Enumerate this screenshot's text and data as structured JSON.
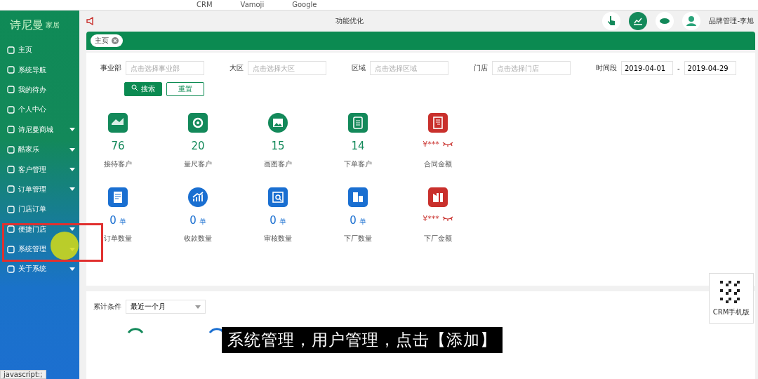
{
  "bookmarks": [
    "CRM",
    "Vamoji",
    "Google"
  ],
  "sidebar": {
    "logo": "诗尼曼",
    "logo_sub": "家居",
    "items": [
      {
        "label": "主页",
        "expandable": false
      },
      {
        "label": "系统导航",
        "expandable": false
      },
      {
        "label": "我的待办",
        "expandable": false
      },
      {
        "label": "个人中心",
        "expandable": false
      },
      {
        "label": "诗尼曼商城",
        "expandable": true
      },
      {
        "label": "酷家乐",
        "expandable": true
      },
      {
        "label": "客户管理",
        "expandable": true
      },
      {
        "label": "订单管理",
        "expandable": true
      },
      {
        "label": "门店订单",
        "expandable": false
      },
      {
        "label": "便捷门店",
        "expandable": true
      },
      {
        "label": "系统管理",
        "expandable": true
      },
      {
        "label": "关于系统",
        "expandable": true
      }
    ]
  },
  "topbar": {
    "notice": "功能优化",
    "user": "品牌管理-李旭"
  },
  "tabs": [
    {
      "label": "主页",
      "selected": true
    }
  ],
  "filters": [
    {
      "label": "事业部",
      "placeholder": "点击选择事业部"
    },
    {
      "label": "大区",
      "placeholder": "点击选择大区"
    },
    {
      "label": "区域",
      "placeholder": "点击选择区域"
    },
    {
      "label": "门店",
      "placeholder": "点击选择门店"
    }
  ],
  "period": {
    "label": "时间段",
    "start": "2019-04-01",
    "separator": "-",
    "end": "2019-04-29"
  },
  "buttons": {
    "search": "搜索",
    "reset": "重置"
  },
  "stats": [
    {
      "kind": "count",
      "value": "76",
      "label": "接待客户",
      "color": "#13895a"
    },
    {
      "kind": "count",
      "value": "20",
      "label": "量尺客户",
      "color": "#13895a"
    },
    {
      "kind": "count",
      "value": "15",
      "label": "画图客户",
      "color": "#13895a"
    },
    {
      "kind": "count",
      "value": "14",
      "label": "下单客户",
      "color": "#13895a"
    },
    {
      "kind": "amount",
      "value": "¥***",
      "label": "合同金额",
      "color": "#c9302c"
    },
    {
      "kind": "count",
      "value": "0",
      "unit": "单",
      "label": "订单数量",
      "color": "#1a6fd1"
    },
    {
      "kind": "count",
      "value": "0",
      "unit": "单",
      "label": "收款数量",
      "color": "#1a6fd1"
    },
    {
      "kind": "count",
      "value": "0",
      "unit": "单",
      "label": "审核数量",
      "color": "#1a6fd1"
    },
    {
      "kind": "count",
      "value": "0",
      "unit": "单",
      "label": "下厂数量",
      "color": "#1a6fd1"
    },
    {
      "kind": "amount",
      "value": "¥***",
      "label": "下厂金额",
      "color": "#c9302c"
    }
  ],
  "summary": {
    "label": "累计条件",
    "value": "最近一个月"
  },
  "qr": {
    "caption": "CRM手机版"
  },
  "subtitle": "系统管理，用户管理，点击【添加】",
  "status_bar": "javascript:;"
}
